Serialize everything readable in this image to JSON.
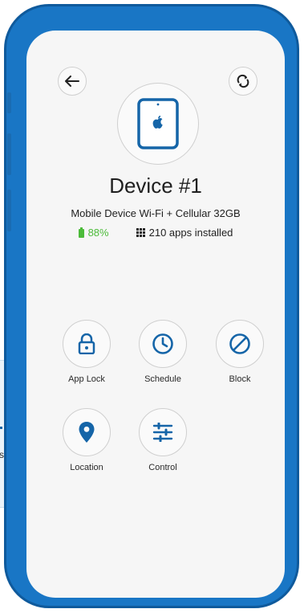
{
  "device": {
    "name": "Device #1",
    "model": "Mobile Device Wi-Fi + Cellular 32GB",
    "battery": "88%",
    "apps": "210 apps installed"
  },
  "actions": [
    {
      "label": "App Lock",
      "icon": "lock-icon"
    },
    {
      "label": "Schedule",
      "icon": "clock-icon"
    },
    {
      "label": "Block",
      "icon": "block-icon"
    },
    {
      "label": "Location",
      "icon": "location-pin-icon"
    },
    {
      "label": "Control",
      "icon": "sliders-icon"
    }
  ],
  "callout": {
    "fragment": "s"
  },
  "colors": {
    "accent": "#1565a8",
    "phone_body": "#1976c5",
    "battery_green": "#4cbb3a"
  }
}
